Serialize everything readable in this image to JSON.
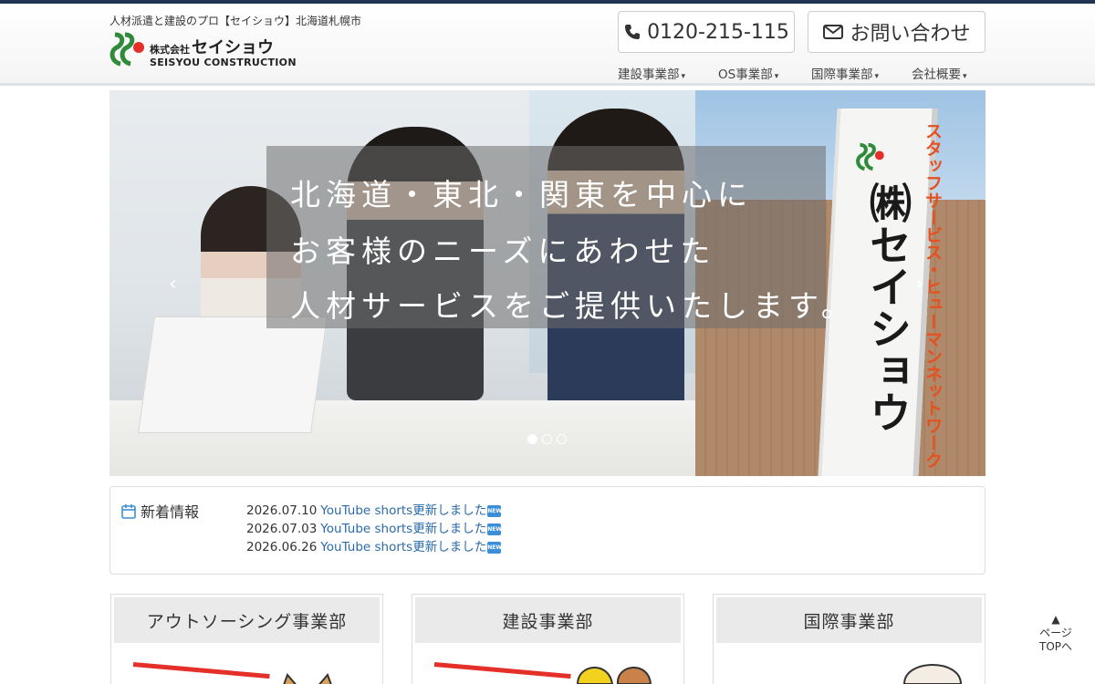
{
  "header": {
    "tagline": "人材派遣と建設のプロ【セイショウ】北海道札幌市",
    "logo": {
      "prefix": "株式会社",
      "name": "セイショウ",
      "sub": "SEISYOU CONSTRUCTION"
    },
    "phone_label": "0120-215-115",
    "contact_label": "お問い合わせ",
    "nav": [
      {
        "label": "建設事業部"
      },
      {
        "label": "OS事業部"
      },
      {
        "label": "国際事業部"
      },
      {
        "label": "会社概要"
      }
    ]
  },
  "hero": {
    "copy_lines": [
      "北海道・東北・関東を中心に",
      "お客様のニーズにあわせた",
      "人材サービスをご提供いたします。"
    ],
    "sign_text": "㈱セイショウ",
    "sign_side": "スタッフサービス・ヒューマンネットワーク",
    "prev_arrow": "‹",
    "next_arrow": "›",
    "slide_count": 3,
    "active_slide": 1
  },
  "news": {
    "heading": "新着情報",
    "items": [
      {
        "date": "2026.07.10",
        "title": "YouTube shorts更新しました"
      },
      {
        "date": "2026.07.03",
        "title": "YouTube shorts更新しました"
      },
      {
        "date": "2026.06.26",
        "title": "YouTube shorts更新しました"
      }
    ],
    "badge": "NEW"
  },
  "divisions": [
    {
      "label": "アウトソーシング事業部"
    },
    {
      "label": "建設事業部"
    },
    {
      "label": "国際事業部"
    }
  ],
  "page_top": {
    "arrow": "▲",
    "line1": "ページ",
    "line2": "TOPへ"
  },
  "colors": {
    "brand_dark": "#1f3553",
    "brand_green": "#2f8a3a",
    "brand_red": "#e5302a",
    "link": "#2a6aa8"
  }
}
